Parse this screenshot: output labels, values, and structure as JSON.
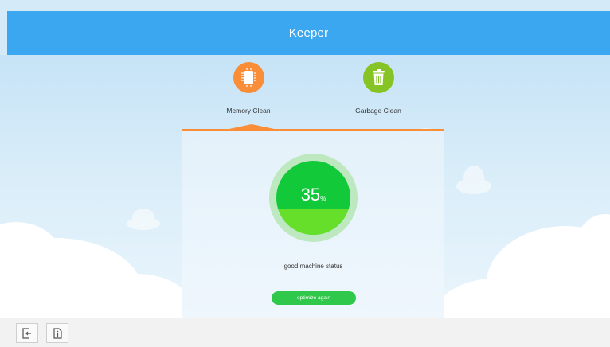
{
  "app": {
    "title": "Keeper"
  },
  "nav": {
    "items": [
      {
        "label": "Memory Clean",
        "icon": "memory-chip-icon",
        "color": "#f98d38"
      },
      {
        "label": "Garbage Clean",
        "icon": "trash-icon",
        "color": "#86c325"
      }
    ]
  },
  "panel": {
    "value": "35",
    "unit": "%",
    "fill_fraction": 0.35,
    "status": "good machine status",
    "button_label": "optimize again"
  },
  "bottombar": {
    "icons": [
      "exit-icon",
      "info-icon"
    ]
  },
  "colors": {
    "header": "#3aa7f0",
    "accent": "#f98d38",
    "good": "#12c93a"
  }
}
